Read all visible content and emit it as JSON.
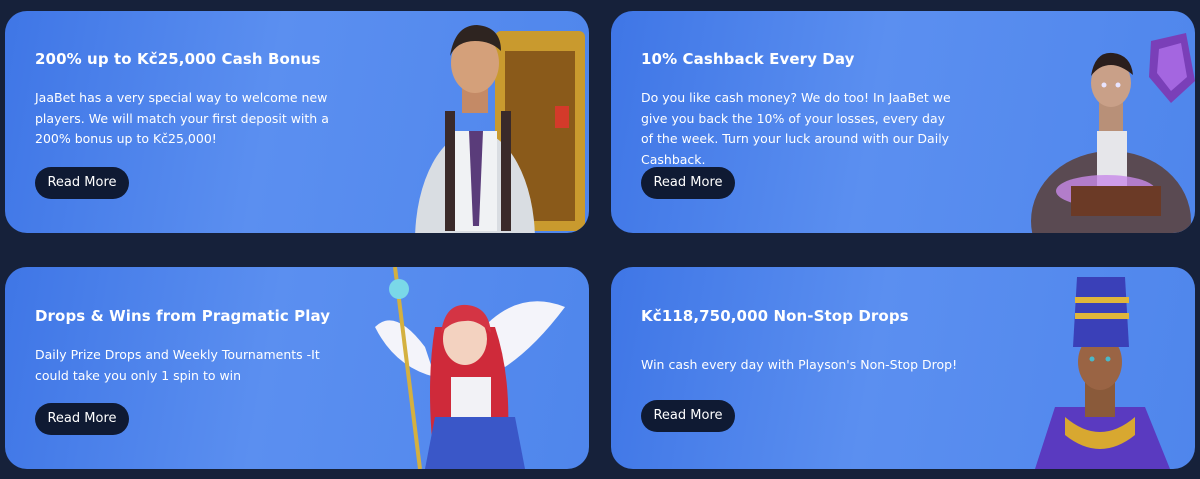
{
  "promotions": [
    {
      "title": "200% up to Kč25,000 Cash Bonus",
      "description": "JaaBet has a very special way to welcome new players. We will match your first deposit with a 200% bonus up to Kč25,000!",
      "button_label": "Read More"
    },
    {
      "title": "10% Cashback Every Day",
      "description": "Do you like cash money? We do too! In JaaBet we give you back the 10% of your losses, every day of the week. Turn your luck around with our Daily Cashback.",
      "button_label": "Read More"
    },
    {
      "title": "Drops & Wins from Pragmatic Play",
      "description": "Daily Prize Drops and Weekly Tournaments -It could take you only 1 spin to win",
      "button_label": "Read More"
    },
    {
      "title": "Kč118,750,000 Non-Stop Drops",
      "description": "Win cash every day with Playson's Non-Stop Drop!",
      "button_label": "Read More"
    }
  ],
  "colors": {
    "page_background": "#16213a",
    "card_gradient_start": "#3f76e6",
    "card_gradient_end": "#5b8ff0",
    "button_background": "#0f1a33",
    "text": "#ffffff"
  },
  "icons": {
    "card1_art": "adventurer-character-illustration",
    "card2_art": "magician-with-book-illustration",
    "card3_art": "anime-angel-girl-illustration",
    "card4_art": "egyptian-queen-illustration"
  }
}
